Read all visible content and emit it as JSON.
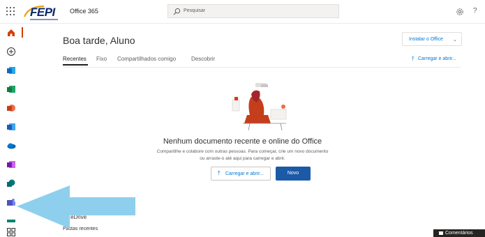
{
  "header": {
    "app_title": "Office 365",
    "logo_text": "FEPI",
    "search_placeholder": "Pesquisar",
    "help_glyph": "?"
  },
  "main": {
    "greeting": "Boa tarde, Aluno",
    "install_button": "Instalar o Office",
    "tabs": [
      {
        "label": "Recentes",
        "active": true
      },
      {
        "label": "Fixo",
        "active": false
      },
      {
        "label": "Compartilhados comigo",
        "active": false
      },
      {
        "label": "Descobrir",
        "active": false
      }
    ],
    "upload_link": "Carregar e abrir...",
    "empty_state": {
      "title": "Nenhum documento recente e online do Office",
      "desc_line1": "Compartilhe e colabore com outras pessoas. Para começar, crie um novo documento",
      "desc_line2": "ou arraste-o até aqui para carregar e abrir."
    },
    "upload_button": "Carregar e abrir...",
    "new_button": "Novo",
    "onedrive_label": "eDrive",
    "recent_folders_label": "Pastas recentes"
  },
  "rail": {
    "items": [
      {
        "icon": "home-icon",
        "color": "#d83b01"
      },
      {
        "icon": "add-icon",
        "color": "#605e5c"
      },
      {
        "icon": "outlook-icon",
        "color": "#0f6cbd"
      },
      {
        "icon": "excel-icon",
        "color": "#107c41"
      },
      {
        "icon": "powerpoint-icon",
        "color": "#c43e1c"
      },
      {
        "icon": "word-icon",
        "color": "#185abd"
      },
      {
        "icon": "onedrive-icon",
        "color": "#0364b8"
      },
      {
        "icon": "onenote-icon",
        "color": "#7719aa"
      },
      {
        "icon": "sharepoint-icon",
        "color": "#036c70"
      },
      {
        "icon": "teams-icon",
        "color": "#4b53bc"
      },
      {
        "icon": "sway-icon",
        "color": "#008272"
      },
      {
        "icon": "all-apps-icon",
        "color": "#605e5c"
      }
    ]
  },
  "feedback": {
    "label": "Comentários"
  },
  "colors": {
    "accent": "#0078d4",
    "primary_button": "#1b5aa6",
    "arrow": "#8fcfee"
  }
}
